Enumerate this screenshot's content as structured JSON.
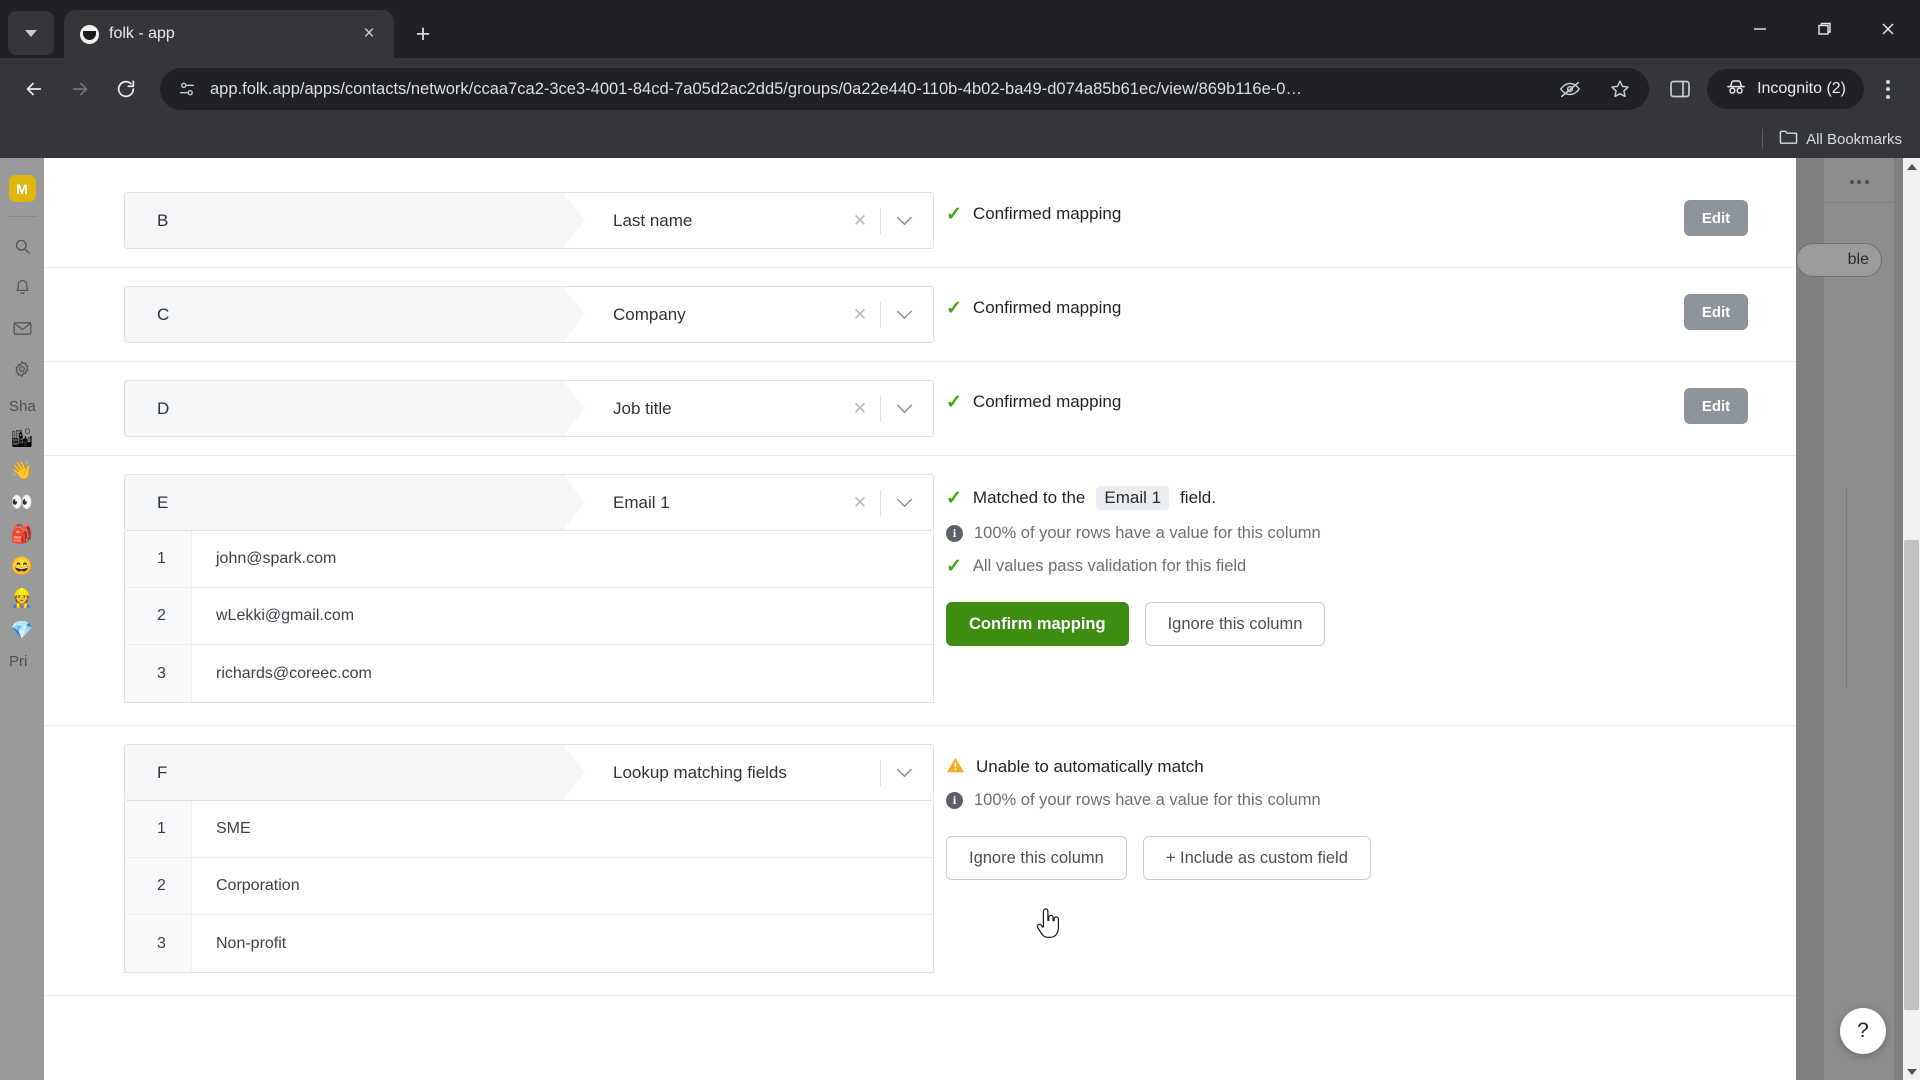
{
  "browser": {
    "tab": {
      "title": "folk - app",
      "favicon": "folk-favicon",
      "close_label": "×"
    },
    "newtab_label": "+",
    "tabsearch_label": "tab-search",
    "window": {
      "minimize": "–",
      "maximize": "❐",
      "close": "×"
    },
    "nav": {
      "back": "←",
      "forward": "→",
      "reload": "↻"
    },
    "omnibox": {
      "url": "app.folk.app/apps/contacts/network/ccaa7ca2-3ce3-4001-84cd-7a05d2ac2dd5/groups/0a22e440-110b-4b02-ba49-d074a85b61ec/view/869b116e-0…",
      "site_icon": "page-info-icon",
      "tracking_icon": "eye-crossed-icon",
      "bookmark_icon": "star-icon",
      "sidepanel_icon": "side-panel-icon"
    },
    "profile": {
      "label": "Incognito (2)",
      "icon": "incognito-hat-icon"
    },
    "menu_label": "chrome-menu",
    "bookmarks": {
      "label": "All Bookmarks",
      "icon": "folder-icon"
    }
  },
  "app_sidebar": {
    "logo": "M",
    "icons": [
      {
        "name": "search-icon",
        "glyph": "⌕"
      },
      {
        "name": "bell-icon",
        "glyph": "○"
      },
      {
        "name": "mail-icon",
        "glyph": "✉"
      },
      {
        "name": "gear-icon",
        "glyph": "⚙"
      }
    ],
    "section_label": "Sha",
    "emojis": [
      "🏙",
      "👋",
      "👀",
      "🎒",
      "😄",
      "👷",
      "💎"
    ],
    "footer_label": "Pri"
  },
  "app_rail": {
    "more_label": "•••",
    "view_pill": "ble"
  },
  "import": {
    "rows": [
      {
        "letter": "B",
        "field": "Last name",
        "has_clear": true,
        "clear_label": "✕",
        "status_icon": "check",
        "status_text": "Confirmed mapping",
        "action": "Edit",
        "preview": []
      },
      {
        "letter": "C",
        "field": "Company",
        "has_clear": true,
        "clear_label": "✕",
        "status_icon": "check",
        "status_text": "Confirmed mapping",
        "action": "Edit",
        "preview": []
      },
      {
        "letter": "D",
        "field": "Job title",
        "has_clear": true,
        "clear_label": "✕",
        "status_icon": "check",
        "status_text": "Confirmed mapping",
        "action": "Edit",
        "preview": []
      }
    ],
    "email_row": {
      "letter": "E",
      "field": "Email 1",
      "clear_label": "✕",
      "preview": [
        {
          "num": "1",
          "value": "john@spark.com"
        },
        {
          "num": "2",
          "value": "wLekki@gmail.com"
        },
        {
          "num": "3",
          "value": "richards@coreec.com"
        }
      ],
      "matched_prefix": "Matched to the",
      "matched_chip": "Email 1",
      "matched_suffix": "field.",
      "coverage_text": "100% of your rows have a value for this column",
      "validation_text": "All values pass validation for this field",
      "confirm_label": "Confirm mapping",
      "ignore_label": "Ignore this column"
    },
    "lookup_row": {
      "letter": "F",
      "field": "Lookup matching fields",
      "preview": [
        {
          "num": "1",
          "value": "SME"
        },
        {
          "num": "2",
          "value": "Corporation"
        },
        {
          "num": "3",
          "value": "Non-profit"
        }
      ],
      "warn_text": "Unable to automatically match",
      "coverage_text": "100% of your rows have a value for this column",
      "ignore_label": "Ignore this column",
      "custom_label": "+ Include as custom field"
    }
  },
  "help": {
    "label": "?"
  },
  "colors": {
    "confirm_green": "#3e8c12",
    "check_green": "#3ea711",
    "warn_amber": "#f0ad20",
    "edit_gray": "#8e949c",
    "chrome_dark": "#202124",
    "chrome_toolbar": "#35363a",
    "brand_yellow": "#e0b50e"
  }
}
